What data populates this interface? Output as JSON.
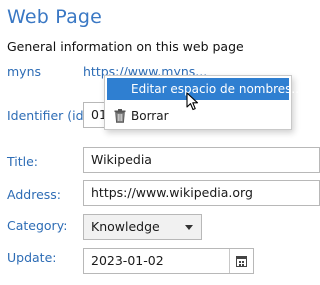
{
  "page": {
    "title": "Web Page",
    "subtitle": "General information on this web page"
  },
  "fields": {
    "namespace_label": "myns",
    "namespace_value": "https://www.myns...",
    "identifier_label": "Identifier (id):",
    "identifier_value": "01",
    "title_label": "Title:",
    "title_value": "Wikipedia",
    "address_label": "Address:",
    "address_value": "https://www.wikipedia.org",
    "category_label": "Category:",
    "category_value": "Knowledge",
    "update_label": "Update:",
    "update_value": "2023-01-02"
  },
  "context_menu": {
    "edit_label": "Editar espacio de nombres...",
    "delete_label": "Borrar"
  },
  "icons": {
    "dropdown": "chevron-down-icon",
    "calendar": "calendar-icon",
    "delete": "trash-icon",
    "pointer": "mouse-cursor-icon"
  },
  "colors": {
    "accent": "#3a78c4",
    "label": "#2d6cb5",
    "menu_highlight": "#2f7fd1"
  }
}
